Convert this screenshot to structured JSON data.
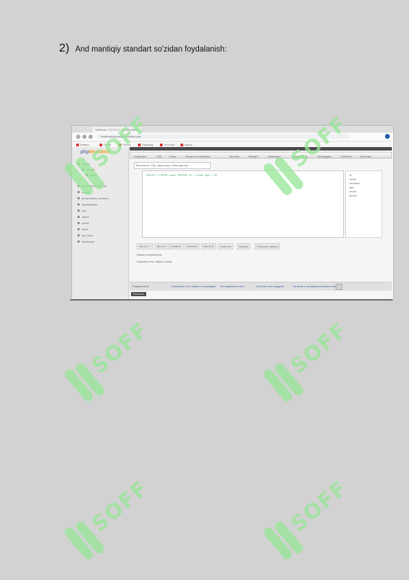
{
  "heading": {
    "number": "2)",
    "text": "And mantiqiy standart so'zidan foydalanish:"
  },
  "watermark": {
    "text": "SOFF",
    "color": "#96e696"
  },
  "screenshot": {
    "browser_tab": "localhost / 127.0.0.1 | phpMyAdmin",
    "address": "localhost/phpmyadmin/index.php",
    "bookmarks": [
      "Бабиш",
      "Gmail",
      "Почта",
      "Перевод",
      "YouTube",
      "Карты"
    ],
    "logo_main": "php",
    "logo_accent": "MyAdmin",
    "left_tree": [
      "Новая",
      "bazalar",
      "sheet",
      "information_schema",
      "mysql",
      "performance_schema",
      "phpmyadmin",
      "test",
      "zakaz",
      "univer",
      "users",
      "sql_baza",
      "kutubxona"
    ],
    "menu": [
      "Структура",
      "SQL",
      "Поиск",
      "Запрос по шаблону",
      "Экспорт",
      "Импорт",
      "Операции",
      "Привилегии",
      "Процедуры",
      "События",
      "Триггеры"
    ],
    "query_label": "Выполнить SQL-запрос(ы) к базе данных",
    "query_text": "SELECT * FROM `users` WHERE `id` > 1 AND `age` < 25",
    "side_items": [
      "id",
      "name",
      "surname",
      "age",
      "email",
      "phone"
    ],
    "buttons": [
      "SELECT *",
      "SELECT",
      "INSERT",
      "UPDATE",
      "DELETE",
      "Очистить",
      "Формат",
      "Получить запрос"
    ],
    "options": [
      "Связать параметры",
      "Показать этот запрос снова"
    ],
    "bottom_items": [
      "Разделитель",
      "Сохранить этот запрос в закладках",
      "Не закрывать окно",
      "Откатить при неудаче",
      "Включить проверку внешних ключей"
    ],
    "go_label": "Вперёд",
    "console_label": "Консоль"
  }
}
